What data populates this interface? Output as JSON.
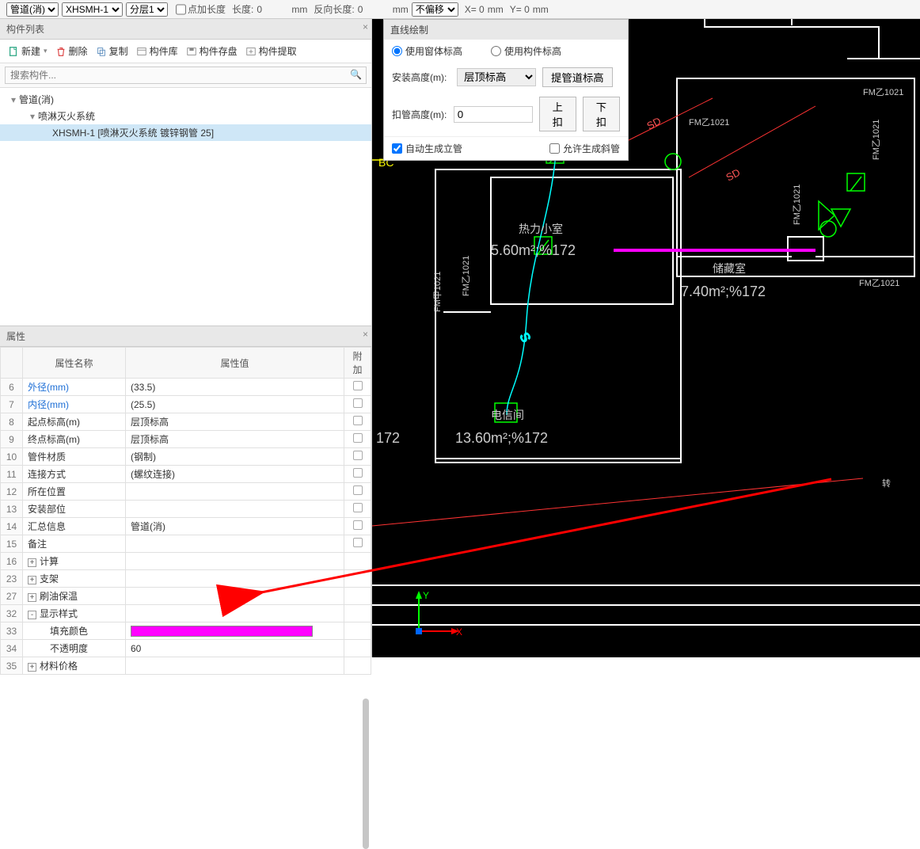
{
  "topbar": {
    "sel1": "管道(消)",
    "sel2": "XHSMH-1",
    "sel3": "分层1",
    "chk_addlen": "点加长度",
    "lbl_len": "长度:",
    "len_val": "0",
    "lbl_unit1": "mm",
    "lbl_revlen": "反向长度:",
    "revlen_val": "0",
    "lbl_unit2": "mm",
    "sel4": "不偏移",
    "lbl_x": "X= 0",
    "lbl_xmm": "mm",
    "lbl_y": "Y= 0",
    "lbl_ymm": "mm"
  },
  "component_list": {
    "title": "构件列表",
    "btn_new": "新建",
    "btn_del": "删除",
    "btn_copy": "复制",
    "btn_lib": "构件库",
    "btn_save": "构件存盘",
    "btn_extract": "构件提取",
    "search_placeholder": "搜索构件...",
    "tree": {
      "n0": "管道(消)",
      "n1": "喷淋灭火系统",
      "n2": "XHSMH-1 [喷淋灭火系统 镀锌钢管 25]"
    }
  },
  "properties": {
    "title": "属性",
    "h_name": "属性名称",
    "h_val": "属性值",
    "h_ext": "附加",
    "rows": [
      {
        "n": "6",
        "name": "外径(mm)",
        "val": "(33.5)",
        "link": true,
        "chk": true
      },
      {
        "n": "7",
        "name": "内径(mm)",
        "val": "(25.5)",
        "link": true,
        "chk": true
      },
      {
        "n": "8",
        "name": "起点标高(m)",
        "val": "层顶标高",
        "chk": true
      },
      {
        "n": "9",
        "name": "终点标高(m)",
        "val": "层顶标高",
        "chk": true
      },
      {
        "n": "10",
        "name": "管件材质",
        "val": "(钢制)",
        "chk": true
      },
      {
        "n": "11",
        "name": "连接方式",
        "val": "(螺纹连接)",
        "chk": true
      },
      {
        "n": "12",
        "name": "所在位置",
        "val": "",
        "chk": true
      },
      {
        "n": "13",
        "name": "安装部位",
        "val": "",
        "chk": true
      },
      {
        "n": "14",
        "name": "汇总信息",
        "val": "管道(消)",
        "chk": true
      },
      {
        "n": "15",
        "name": "备注",
        "val": "",
        "chk": true
      },
      {
        "n": "16",
        "name": "计算",
        "expand": "+"
      },
      {
        "n": "23",
        "name": "支架",
        "expand": "+"
      },
      {
        "n": "27",
        "name": "刷油保温",
        "expand": "+"
      },
      {
        "n": "32",
        "name": "显示样式",
        "expand": "-"
      },
      {
        "n": "33",
        "name": "填充颜色",
        "val": "__COLOR__",
        "indent": true
      },
      {
        "n": "34",
        "name": "不透明度",
        "val": "60",
        "indent": true
      },
      {
        "n": "35",
        "name": "材料价格",
        "expand": "+"
      }
    ]
  },
  "dialog": {
    "title": "直线绘制",
    "radio1": "使用窗体标高",
    "radio2": "使用构件标高",
    "install_lbl": "安装高度(m):",
    "install_sel": "层顶标高",
    "btn_lift": "提管道标高",
    "deduct_lbl": "扣管高度(m):",
    "deduct_val": "0",
    "btn_up": "上扣",
    "btn_down": "下扣",
    "chk_auto": "自动生成立管",
    "chk_slant": "允许生成斜管"
  },
  "canvas": {
    "labels": {
      "room1": "热力小室",
      "room1_area": "5.60m²;%172",
      "room2": "储藏室",
      "room2_area": "7.40m²;%172",
      "room3": "电信间",
      "room3_area": "13.60m²;%172",
      "stray_172": "172",
      "fm": "FM乙1021",
      "fm2": "FM乙1021",
      "fm3": "FM乙1021",
      "fm4": "FM乙1021",
      "fm5": "FM甲1021",
      "bc": "BC",
      "sd1": "SD",
      "sd2": "SD",
      "axis_x": "X",
      "axis_y": "Y",
      "rot": "转"
    }
  }
}
